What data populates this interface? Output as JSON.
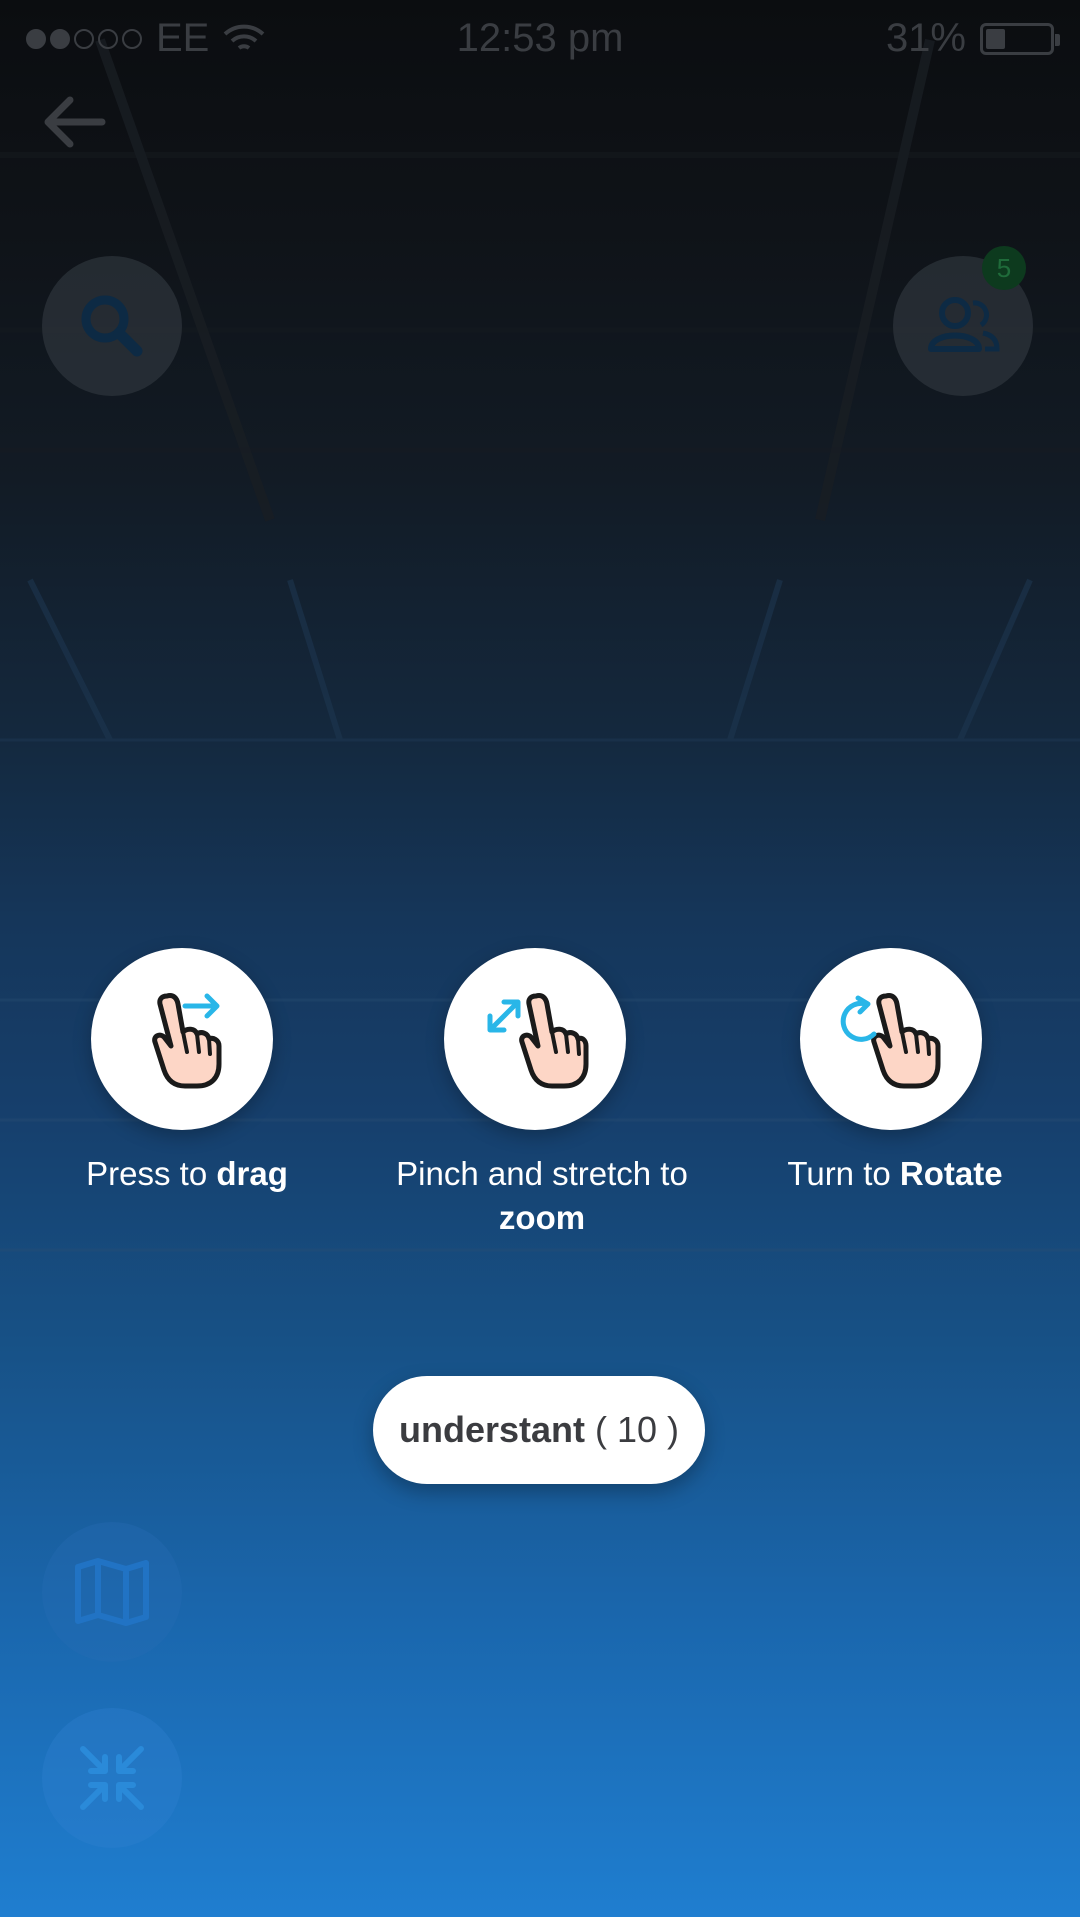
{
  "status_bar": {
    "carrier": "EE",
    "time": "12:53 pm",
    "battery_percent": "31%",
    "battery_level": 0.31,
    "signal_bars_filled": 2,
    "signal_bars_total": 5
  },
  "badge": {
    "count": "5"
  },
  "gestures": [
    {
      "icon": "drag-hand-icon",
      "label_prefix": "Press to ",
      "label_bold": "drag",
      "label_suffix": ""
    },
    {
      "icon": "pinch-zoom-hand-icon",
      "label_prefix": "Pinch and stretch to ",
      "label_bold": "zoom",
      "label_suffix": ""
    },
    {
      "icon": "rotate-hand-icon",
      "label_prefix": "Turn to ",
      "label_bold": "Rotate",
      "label_suffix": ""
    }
  ],
  "understand_button": {
    "label": "understant",
    "countdown": "( 10 )"
  },
  "colors": {
    "accent": "#29b6e8",
    "background_top": "#0b0d10",
    "background_bottom": "#1f7ed0",
    "skin": "#fdd6c6"
  }
}
